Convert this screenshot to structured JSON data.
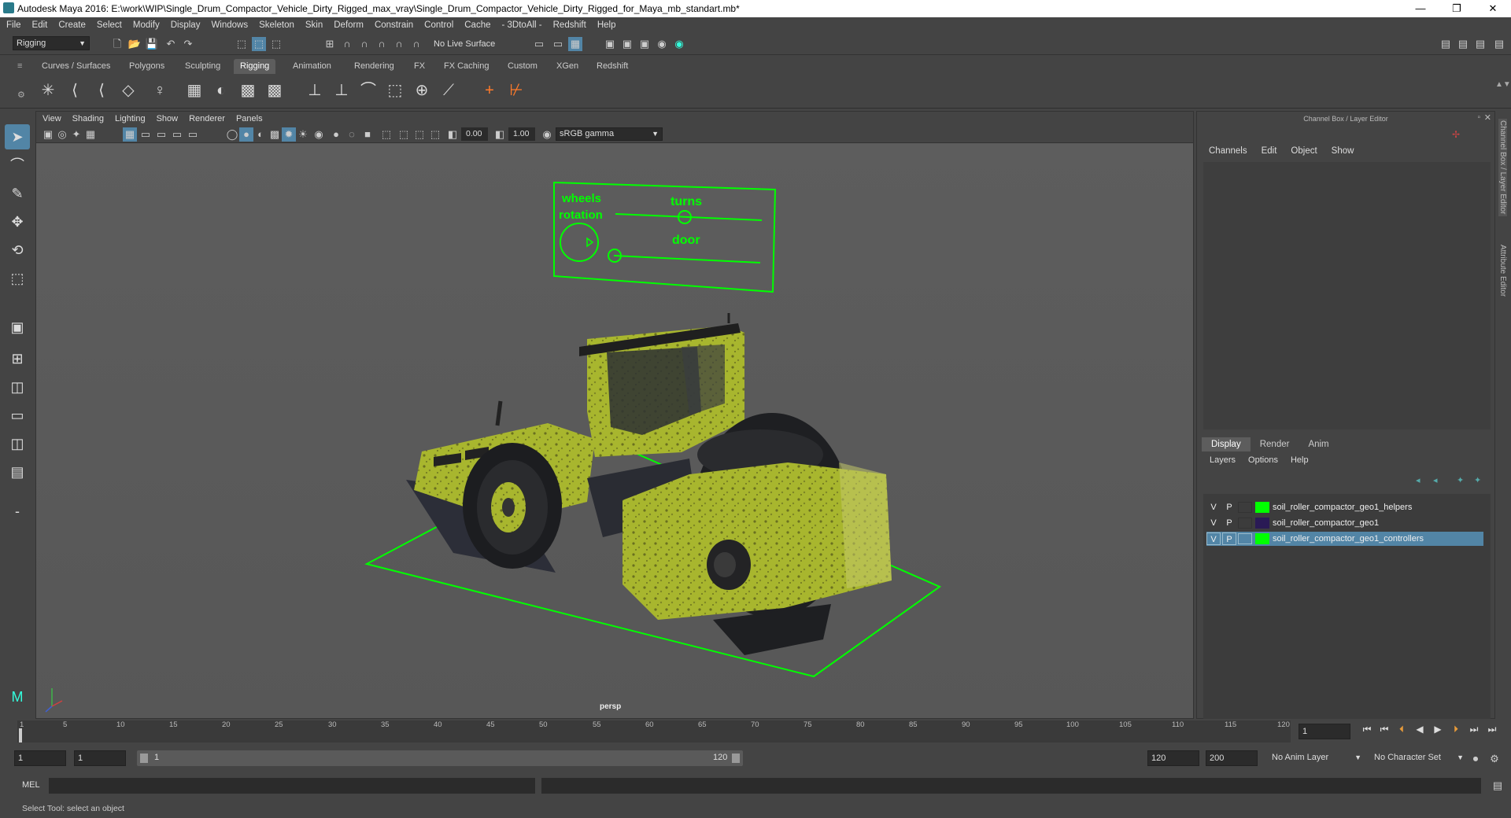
{
  "window": {
    "title": "Autodesk Maya 2016: E:\\work\\WIP\\Single_Drum_Compactor_Vehicle_Dirty_Rigged_max_vray\\Single_Drum_Compactor_Vehicle_Dirty_Rigged_for_Maya_mb_standart.mb*",
    "minimize": "—",
    "restore": "❐",
    "close": "✕"
  },
  "menubar": [
    "File",
    "Edit",
    "Create",
    "Select",
    "Modify",
    "Display",
    "Windows",
    "Skeleton",
    "Skin",
    "Deform",
    "Constrain",
    "Control",
    "Cache",
    "- 3DtoAll -",
    "Redshift",
    "Help"
  ],
  "statusline": {
    "menuset": "Rigging",
    "live_surface": "No Live Surface"
  },
  "shelf_tabs": [
    "Curves / Surfaces",
    "Polygons",
    "Sculpting",
    "Rigging",
    "Animation",
    "Rendering",
    "FX",
    "FX Caching",
    "Custom",
    "XGen",
    "Redshift"
  ],
  "active_shelf_tab": "Rigging",
  "viewport": {
    "menu": [
      "View",
      "Shading",
      "Lighting",
      "Show",
      "Renderer",
      "Panels"
    ],
    "exposure": "0.00",
    "gamma": "1.00",
    "color_space": "sRGB gamma",
    "camera": "persp",
    "controller_labels": {
      "wheels": "wheels",
      "rotation": "rotation",
      "turns": "turns",
      "door": "door"
    }
  },
  "channel_box": {
    "title": "Channel Box / Layer Editor",
    "menu": [
      "Channels",
      "Edit",
      "Object",
      "Show"
    ]
  },
  "layer_editor": {
    "tabs": [
      "Display",
      "Render",
      "Anim"
    ],
    "active_tab": "Display",
    "menu": [
      "Layers",
      "Options",
      "Help"
    ],
    "layers": [
      {
        "v": "V",
        "p": "P",
        "color": "#00ff00",
        "name": "soil_roller_compactor_geo1_helpers"
      },
      {
        "v": "V",
        "p": "P",
        "color": "#2a1a55",
        "name": "soil_roller_compactor_geo1"
      },
      {
        "v": "V",
        "p": "P",
        "color": "#00ff00",
        "name": "soil_roller_compactor_geo1_controllers"
      }
    ]
  },
  "side_tabs": [
    "Channel Box / Layer Editor",
    "Attribute Editor"
  ],
  "timeslider": {
    "ticks": [
      "1",
      "5",
      "10",
      "15",
      "20",
      "25",
      "30",
      "35",
      "40",
      "45",
      "50",
      "55",
      "60",
      "65",
      "70",
      "75",
      "80",
      "85",
      "90",
      "95",
      "100",
      "105",
      "110",
      "115",
      "120"
    ],
    "current_frame": "1"
  },
  "range": {
    "start": "1",
    "playback_start": "1",
    "slider_start": "1",
    "slider_end": "120",
    "playback_end": "120",
    "end": "200",
    "anim_layer": "No Anim Layer",
    "char_set": "No Character Set"
  },
  "cmdline": {
    "label": "MEL"
  },
  "helpline": "Select Tool: select an object"
}
